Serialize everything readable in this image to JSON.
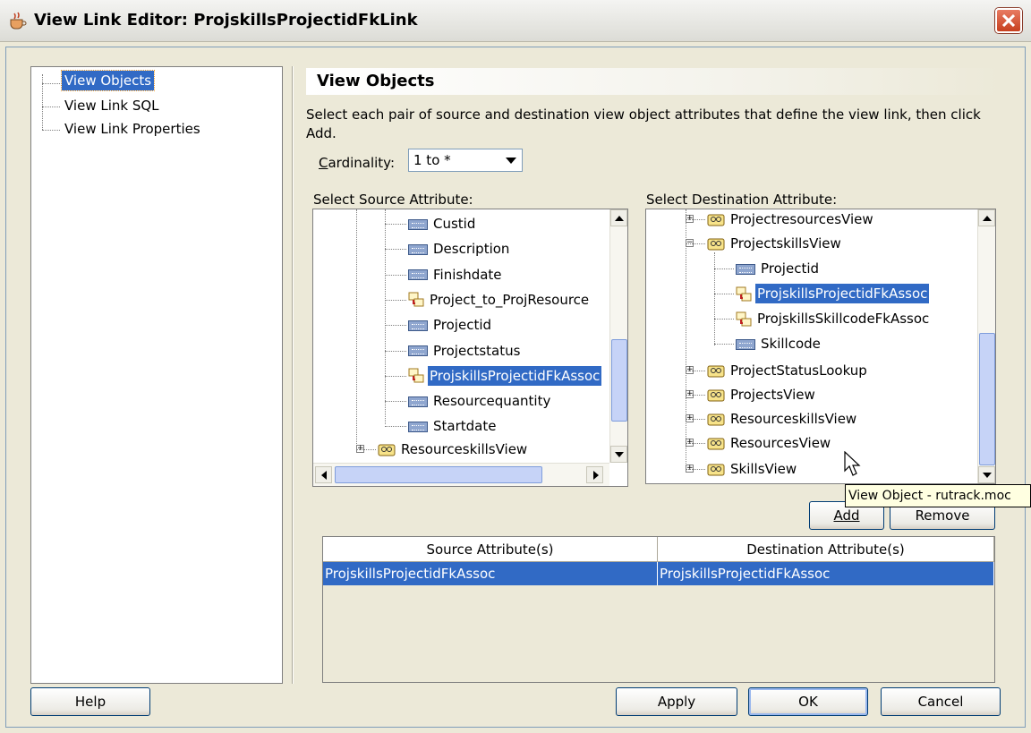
{
  "window": {
    "title": "View Link Editor: ProjskillsProjectidFkLink"
  },
  "nav": {
    "items": [
      "View Objects",
      "View Link SQL",
      "View Link Properties"
    ]
  },
  "header": {
    "title": "View Objects"
  },
  "instructions": "Select each pair of source and destination view object attributes that define the view link, then click Add.",
  "cardinality": {
    "label": "Cardinality:",
    "value": "1 to *"
  },
  "source": {
    "label": "Select Source Attribute:",
    "items": [
      {
        "text": "Custid",
        "kind": "attribute-icon"
      },
      {
        "text": "Description",
        "kind": "attribute-icon"
      },
      {
        "text": "Finishdate",
        "kind": "attribute-icon"
      },
      {
        "text": "Project_to_ProjResource",
        "kind": "association-icon"
      },
      {
        "text": "Projectid",
        "kind": "attribute-icon"
      },
      {
        "text": "Projectstatus",
        "kind": "attribute-icon"
      },
      {
        "text": "ProjskillsProjectidFkAssoc",
        "kind": "association-icon"
      },
      {
        "text": "Resourcequantity",
        "kind": "attribute-icon"
      },
      {
        "text": "Startdate",
        "kind": "attribute-icon"
      },
      {
        "text": "ResourceskillsView",
        "kind": "view-object-icon"
      }
    ]
  },
  "destination": {
    "label": "Select Destination Attribute:",
    "items": [
      {
        "text": "ProjectresourcesView",
        "kind": "view-object-icon"
      },
      {
        "text": "ProjectskillsView",
        "kind": "view-object-icon"
      },
      {
        "text": "Projectid",
        "kind": "attribute-icon"
      },
      {
        "text": "ProjskillsProjectidFkAssoc",
        "kind": "association-icon"
      },
      {
        "text": "ProjskillsSkillcodeFkAssoc",
        "kind": "association-icon"
      },
      {
        "text": "Skillcode",
        "kind": "attribute-icon"
      },
      {
        "text": "ProjectStatusLookup",
        "kind": "view-object-icon"
      },
      {
        "text": "ProjectsView",
        "kind": "view-object-icon"
      },
      {
        "text": "ResourceskillsView",
        "kind": "view-object-icon"
      },
      {
        "text": "ResourcesView",
        "kind": "view-object-icon"
      },
      {
        "text": "SkillsView",
        "kind": "view-object-icon"
      }
    ]
  },
  "tooltip": "View Object - rutrack.moc",
  "buttons": {
    "add": "Add",
    "remove": "Remove",
    "help": "Help",
    "apply": "Apply",
    "ok": "OK",
    "cancel": "Cancel"
  },
  "table": {
    "headers": [
      "Source Attribute(s)",
      "Destination Attribute(s)"
    ],
    "rows": [
      [
        "ProjskillsProjectidFkAssoc",
        "ProjskillsProjectidFkAssoc"
      ]
    ]
  },
  "colors": {
    "selection": "#316ac5",
    "dialog_bg": "#ece9d8",
    "close_button": "#c7401f"
  }
}
